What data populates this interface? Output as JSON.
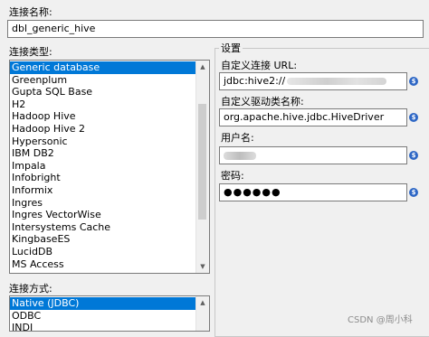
{
  "connection_name": {
    "label": "连接名称:",
    "value": "dbl_generic_hive"
  },
  "connection_type": {
    "label": "连接类型:",
    "items": [
      "Generic database",
      "Greenplum",
      "Gupta SQL Base",
      "H2",
      "Hadoop Hive",
      "Hadoop Hive 2",
      "Hypersonic",
      "IBM DB2",
      "Impala",
      "Infobright",
      "Informix",
      "Ingres",
      "Ingres VectorWise",
      "Intersystems Cache",
      "KingbaseES",
      "LucidDB",
      "MS Access"
    ],
    "selected": "Generic database"
  },
  "access_method": {
    "label": "连接方式:",
    "items": [
      "Native (JDBC)",
      "ODBC",
      "JNDI"
    ],
    "selected": "Native (JDBC)"
  },
  "settings": {
    "title": "设置",
    "custom_url_label": "自定义连接 URL:",
    "custom_url_value": "jdbc:hive2://",
    "custom_driver_label": "自定义驱动类名称:",
    "custom_driver_value": "org.apache.hive.jdbc.HiveDriver",
    "username_label": "用户名:",
    "password_label": "密码:",
    "password_value": "●●●●●●"
  },
  "variable_icon_glyph": "$",
  "watermark": "CSDN @周小科",
  "colors": {
    "selection": "#0078d7",
    "variable_icon": "#2e67c5"
  }
}
